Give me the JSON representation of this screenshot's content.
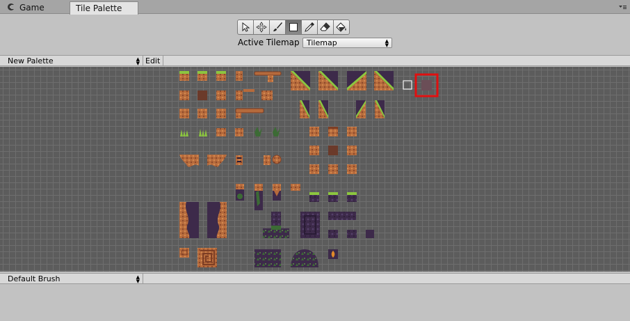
{
  "tabs": [
    {
      "label": "Game",
      "icon": "unity-icon",
      "active": false
    },
    {
      "label": "Tile Palette",
      "active": true
    }
  ],
  "toolbar": {
    "tools": [
      {
        "name": "select-tool",
        "icon": "cursor-icon",
        "active": false
      },
      {
        "name": "move-tool",
        "icon": "move-icon",
        "active": false
      },
      {
        "name": "paint-tool",
        "icon": "brush-icon",
        "active": false
      },
      {
        "name": "box-fill-tool",
        "icon": "box-icon",
        "active": true
      },
      {
        "name": "pick-tool",
        "icon": "eyedropper-icon",
        "active": false
      },
      {
        "name": "erase-tool",
        "icon": "eraser-icon",
        "active": false
      },
      {
        "name": "fill-tool",
        "icon": "paint-bucket-icon",
        "active": false
      }
    ],
    "active_tilemap_label": "Active Tilemap",
    "active_tilemap_value": "Tilemap"
  },
  "palette": {
    "selected": "New Palette",
    "edit_label": "Edit"
  },
  "brush": {
    "selected": "Default Brush"
  },
  "colors": {
    "dirt": "#b56a3c",
    "dirt_dark": "#7e3e24",
    "grass": "#8cc63f",
    "rock_purple": "#3d2a4a",
    "moss": "#3c6b35",
    "empty_cell": "#6b4e57",
    "selection": "#e01010"
  }
}
